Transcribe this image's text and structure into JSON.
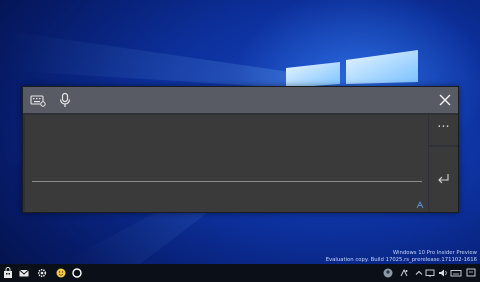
{
  "desktop": {
    "watermark_line1": "Windows 10 Pro Insider Preview",
    "watermark_line2": "Evaluation copy. Build 17025.rs_prerelease.171102-1616"
  },
  "keyboard": {
    "more_label": "···",
    "text_value": ""
  },
  "taskbar": {
    "icons": [
      "store-bag-icon",
      "mail-icon",
      "settings-gear-icon",
      "emoji-icon",
      "cortana-circle-icon"
    ],
    "tray_icons": [
      "user-avatar-icon",
      "people-icon",
      "chevron-up-icon",
      "network-icon",
      "volume-icon",
      "language-icon",
      "keyboard-icon"
    ]
  },
  "colors": {
    "window_bg": "#2f3138",
    "titlebar_bg": "#595b64",
    "text_area_bg": "#3a3a3a",
    "taskbar_bg": "#0a0f18"
  }
}
